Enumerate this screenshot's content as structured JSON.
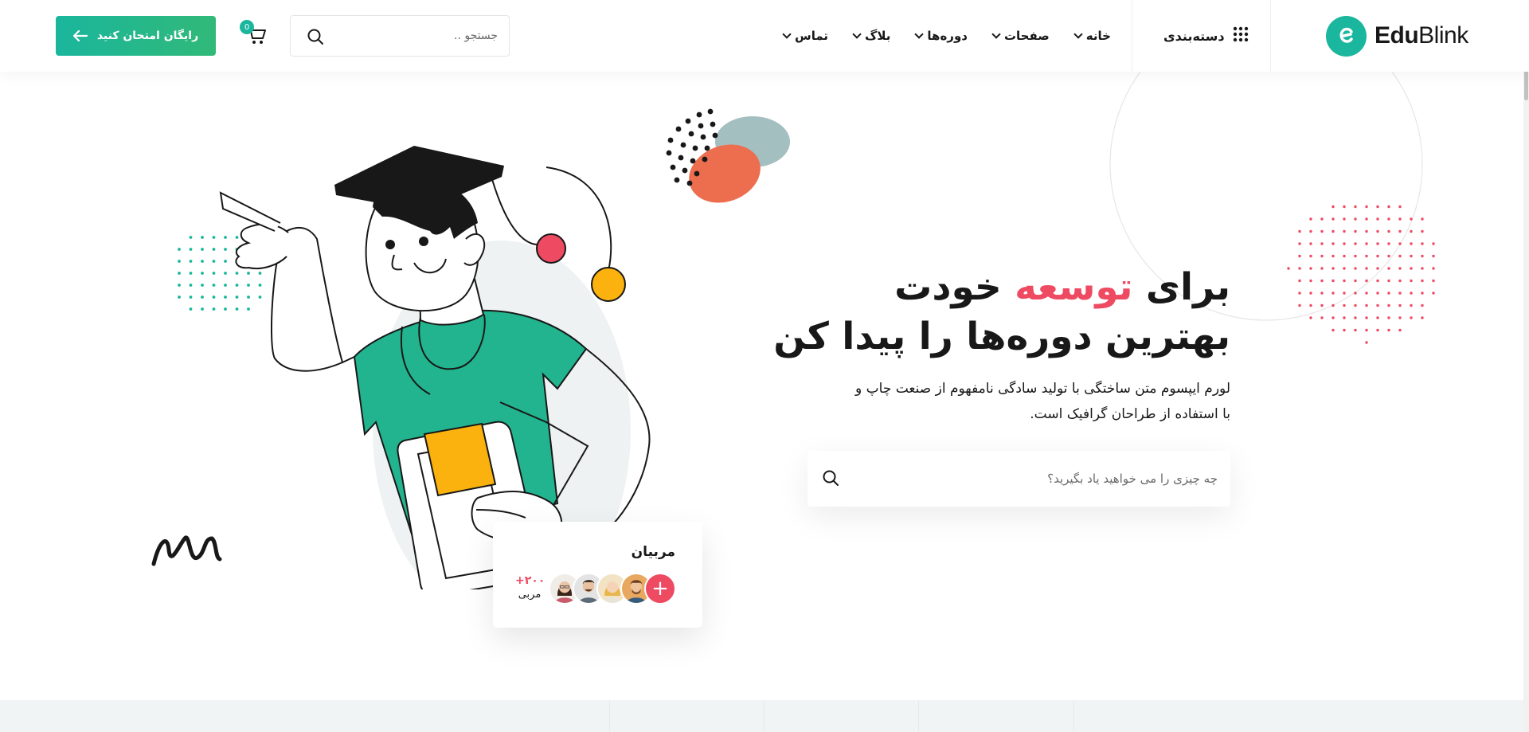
{
  "brand": {
    "name_bold": "Edu",
    "name_light": "Blink",
    "color": "#1ab69d"
  },
  "header": {
    "category_label": "دسته‌بندی",
    "nav": [
      {
        "label": "خانه"
      },
      {
        "label": "صفحات"
      },
      {
        "label": "دوره‌ها"
      },
      {
        "label": "بلاگ"
      },
      {
        "label": "تماس"
      }
    ],
    "search_placeholder": "جستجو ..",
    "cart_count": "0",
    "cta_label": "رایگان امتحان کنید"
  },
  "hero": {
    "title_line1_before": "برای",
    "title_line1_accent": "توسعه",
    "title_line1_after": "خودت",
    "title_line2": "بهترین دوره‌ها را پیدا کن",
    "subtitle_line1": "لورم ایپسوم متن ساختگی با تولید سادگی نامفهوم از صنعت چاپ و",
    "subtitle_line2": "با استفاده از طراحان گرافیک است.",
    "search_placeholder": "چه چیزی را می خواهید یاد بگیرید؟",
    "accent_color": "#ee4a62"
  },
  "instructors": {
    "title": "مربیان",
    "count": "+۲۰۰",
    "count_label": "مربی"
  },
  "icons": [
    "grid-icon",
    "chevron-down-icon",
    "search-icon",
    "cart-icon",
    "arrow-left-icon",
    "plus-icon"
  ]
}
